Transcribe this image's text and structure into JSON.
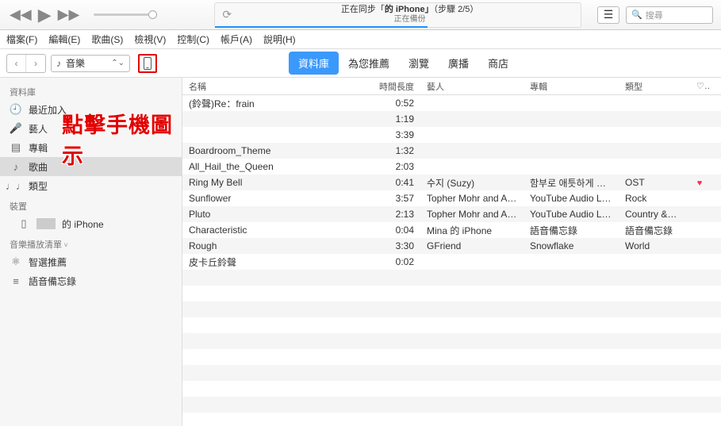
{
  "topbar": {
    "sync": {
      "line1_prefix": "正在同步「",
      "line1_mid": "的 iPhone」",
      "line1_suffix": "（步驟 2/5）",
      "line2": "正在備份"
    },
    "search_placeholder": "搜尋"
  },
  "menubar": [
    "檔案(F)",
    "編輯(E)",
    "歌曲(S)",
    "檢視(V)",
    "控制(C)",
    "帳戶(A)",
    "說明(H)"
  ],
  "navrow": {
    "media_label": "音樂",
    "tabs": [
      "資料庫",
      "為您推薦",
      "瀏覽",
      "廣播",
      "商店"
    ],
    "active_tab": 0
  },
  "annotation_text": "點擊手機圖示",
  "sidebar": {
    "sections": [
      {
        "title": "資料庫",
        "items": [
          {
            "icon": "clock",
            "label": "最近加入"
          },
          {
            "icon": "mic",
            "label": "藝人"
          },
          {
            "icon": "album",
            "label": "專輯"
          },
          {
            "icon": "note",
            "label": "歌曲",
            "selected": true
          },
          {
            "icon": "genre",
            "label": "類型"
          }
        ]
      },
      {
        "title": "裝置",
        "items": [
          {
            "icon": "phone",
            "label": "的 iPhone",
            "indent": true
          }
        ]
      },
      {
        "title": "音樂播放清單",
        "disclose": true,
        "items": [
          {
            "icon": "atom",
            "label": "智選推薦"
          },
          {
            "icon": "list",
            "label": "語音備忘錄"
          }
        ]
      }
    ]
  },
  "columns": {
    "name": "名稱",
    "time": "時間長度",
    "artist": "藝人",
    "album": "專輯",
    "genre": "類型",
    "heart": "♡"
  },
  "songs": [
    {
      "name": "(鈴聲)Re：frain",
      "time": "0:52",
      "artist": "",
      "album": "",
      "genre": "",
      "loved": false
    },
    {
      "name": "",
      "time": "1:19",
      "artist": "",
      "album": "",
      "genre": "",
      "loved": false
    },
    {
      "name": "",
      "time": "3:39",
      "artist": "",
      "album": "",
      "genre": "",
      "loved": false
    },
    {
      "name": "Boardroom_Theme",
      "time": "1:32",
      "artist": "",
      "album": "",
      "genre": "",
      "loved": false
    },
    {
      "name": "All_Hail_the_Queen",
      "time": "2:03",
      "artist": "",
      "album": "",
      "genre": "",
      "loved": false
    },
    {
      "name": "Ring My Bell",
      "time": "0:41",
      "artist": "수지 (Suzy)",
      "album": "함부로 애틋하게 OS…",
      "genre": "OST",
      "loved": true
    },
    {
      "name": "Sunflower",
      "time": "3:57",
      "artist": "Topher Mohr and Al…",
      "album": "YouTube Audio Libr…",
      "genre": "Rock",
      "loved": false
    },
    {
      "name": "Pluto",
      "time": "2:13",
      "artist": "Topher Mohr and Al…",
      "album": "YouTube Audio Libr…",
      "genre": "Country &…",
      "loved": false
    },
    {
      "name": "Characteristic",
      "time": "0:04",
      "artist": "Mina 的 iPhone",
      "album": "語音備忘錄",
      "genre": "語音備忘錄",
      "loved": false
    },
    {
      "name": "Rough",
      "time": "3:30",
      "artist": "GFriend",
      "album": "Snowflake",
      "genre": "World",
      "loved": false
    },
    {
      "name": "皮卡丘鈴聲",
      "time": "0:02",
      "artist": "",
      "album": "",
      "genre": "",
      "loved": false
    }
  ]
}
